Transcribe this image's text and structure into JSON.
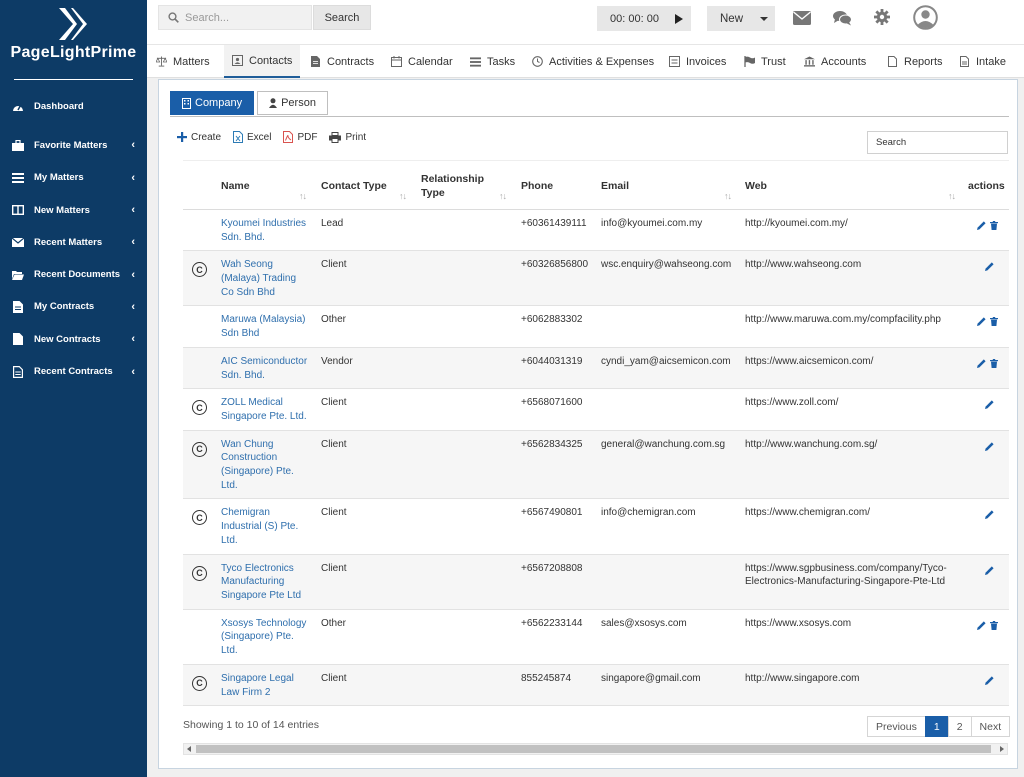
{
  "app": {
    "logo_text": "PageLightPrime"
  },
  "sidebar": {
    "items": [
      {
        "label": "Dashboard",
        "icon": "dashboard-icon"
      },
      {
        "label": "Favorite Matters",
        "icon": "briefcase-icon"
      },
      {
        "label": "My Matters",
        "icon": "list-icon"
      },
      {
        "label": "New Matters",
        "icon": "columns-icon"
      },
      {
        "label": "Recent Matters",
        "icon": "envelope-icon"
      },
      {
        "label": "Recent Documents",
        "icon": "folder-open-icon"
      },
      {
        "label": "My Contracts",
        "icon": "document-icon"
      },
      {
        "label": "New Contracts",
        "icon": "file-icon"
      },
      {
        "label": "Recent Contracts",
        "icon": "file-text-icon"
      }
    ]
  },
  "topbar": {
    "search_placeholder": "Search...",
    "search_button": "Search",
    "timer": "00: 00: 00",
    "new_label": "New"
  },
  "main_tabs": [
    {
      "label": "Matters"
    },
    {
      "label": "Contacts"
    },
    {
      "label": "Contracts"
    },
    {
      "label": "Calendar"
    },
    {
      "label": "Tasks"
    },
    {
      "label": "Activities & Expenses"
    },
    {
      "label": "Invoices"
    },
    {
      "label": "Trust"
    },
    {
      "label": "Accounts"
    },
    {
      "label": "Reports"
    },
    {
      "label": "Intake"
    }
  ],
  "sub_tabs": {
    "company": "Company",
    "person": "Person"
  },
  "toolbar": {
    "create": "Create",
    "excel": "Excel",
    "pdf": "PDF",
    "print": "Print",
    "search_placeholder": "Search"
  },
  "table": {
    "headers": {
      "name": "Name",
      "contact_type": "Contact Type",
      "relationship_type_1": "Relationship",
      "relationship_type_2": "Type",
      "phone": "Phone",
      "email": "Email",
      "web": "Web",
      "actions": "actions"
    },
    "rows": [
      {
        "name_lines": [
          "Kyoumei Industries",
          "Sdn. Bhd."
        ],
        "client_icon": false,
        "type": "Lead",
        "phone": "+60361439111",
        "email": "info@kyoumei.com.my",
        "web_lines": [
          "http://kyoumei.com.my/"
        ],
        "delete": true
      },
      {
        "name_lines": [
          "Wah Seong",
          "(Malaya) Trading",
          "Co Sdn Bhd"
        ],
        "client_icon": true,
        "type": "Client",
        "phone": "+60326856800",
        "email": "wsc.enquiry@wahseong.com",
        "web_lines": [
          "http://www.wahseong.com"
        ],
        "delete": false
      },
      {
        "name_lines": [
          "Maruwa (Malaysia)",
          "Sdn Bhd"
        ],
        "client_icon": false,
        "type": "Other",
        "phone": "+6062883302",
        "email": "",
        "web_lines": [
          "http://www.maruwa.com.my/compfacility.php"
        ],
        "delete": true
      },
      {
        "name_lines": [
          "AIC Semiconductor",
          "Sdn. Bhd."
        ],
        "client_icon": false,
        "type": "Vendor",
        "phone": "+6044031319",
        "email": "cyndi_yam@aicsemicon.com",
        "web_lines": [
          "https://www.aicsemicon.com/"
        ],
        "delete": true
      },
      {
        "name_lines": [
          "ZOLL Medical",
          "Singapore Pte. Ltd."
        ],
        "client_icon": true,
        "type": "Client",
        "phone": "+6568071600",
        "email": "",
        "web_lines": [
          "https://www.zoll.com/"
        ],
        "delete": false
      },
      {
        "name_lines": [
          "Wan Chung",
          "Construction",
          "(Singapore) Pte.",
          "Ltd."
        ],
        "client_icon": true,
        "type": "Client",
        "phone": "+6562834325",
        "email": "general@wanchung.com.sg",
        "web_lines": [
          "http://www.wanchung.com.sg/"
        ],
        "delete": false
      },
      {
        "name_lines": [
          "Chemigran",
          "Industrial (S) Pte.",
          "Ltd."
        ],
        "client_icon": true,
        "type": "Client",
        "phone": "+6567490801",
        "email": "info@chemigran.com",
        "web_lines": [
          "https://www.chemigran.com/"
        ],
        "delete": false
      },
      {
        "name_lines": [
          "Tyco Electronics",
          "Manufacturing",
          "Singapore Pte Ltd"
        ],
        "client_icon": true,
        "type": "Client",
        "phone": "+6567208808",
        "email": "",
        "web_lines": [
          "https://www.sgpbusiness.com/company/Tyco-",
          "Electronics-Manufacturing-Singapore-Pte-Ltd"
        ],
        "delete": false
      },
      {
        "name_lines": [
          "Xsosys Technology",
          "(Singapore) Pte.",
          "Ltd."
        ],
        "client_icon": false,
        "type": "Other",
        "phone": "+6562233144",
        "email": "sales@xsosys.com",
        "web_lines": [
          "https://www.xsosys.com"
        ],
        "delete": true
      },
      {
        "name_lines": [
          "Singapore Legal",
          "Law Firm 2"
        ],
        "client_icon": true,
        "type": "Client",
        "phone": "855245874",
        "email": "singapore@gmail.com",
        "web_lines": [
          "http://www.singapore.com"
        ],
        "delete": false
      }
    ]
  },
  "footer": {
    "info": "Showing 1 to 10 of 14 entries",
    "previous": "Previous",
    "page1": "1",
    "page2": "2",
    "next": "Next"
  },
  "colors": {
    "sidebar": "#0d3b66",
    "accent": "#1a5ea8",
    "link": "#2f6fad"
  }
}
